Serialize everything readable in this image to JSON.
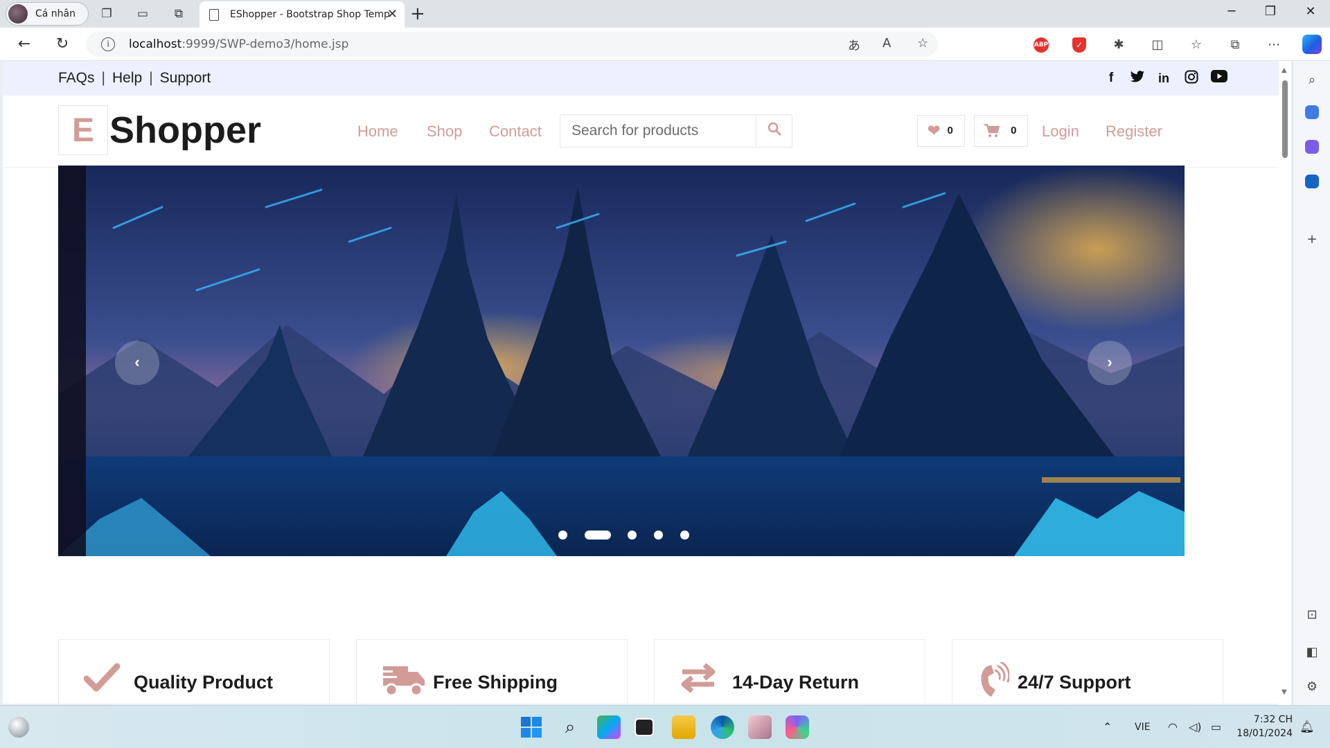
{
  "browser": {
    "profile_label": "Cá nhân",
    "tab_title": "EShopper - Bootstrap Shop Temp",
    "url_host": "localhost",
    "url_rest": ":9999/SWP-demo3/home.jsp",
    "extensions": {
      "abp_label": "ABP"
    }
  },
  "site": {
    "top_links": [
      "FAQs",
      "Help",
      "Support"
    ],
    "social": [
      "facebook-icon",
      "twitter-icon",
      "linkedin-icon",
      "instagram-icon",
      "youtube-icon"
    ],
    "logo_letter": "E",
    "logo_text": "Shopper",
    "menu": [
      "Home",
      "Shop",
      "Contact"
    ],
    "search_placeholder": "Search for products",
    "wishlist_count": "0",
    "cart_count": "0",
    "login": "Login",
    "register": "Register",
    "accent_color": "#d19c97",
    "carousel": {
      "slide_count": 5,
      "active_index": 1
    },
    "features": [
      {
        "icon": "check-icon",
        "label": "Quality Product"
      },
      {
        "icon": "shipping-truck-icon",
        "label": "Free Shipping"
      },
      {
        "icon": "exchange-arrows-icon",
        "label": "14-Day Return"
      },
      {
        "icon": "phone-volume-icon",
        "label": "24/7 Support"
      }
    ]
  },
  "taskbar": {
    "language": "VIE",
    "time": "7:32 CH",
    "date": "18/01/2024"
  }
}
